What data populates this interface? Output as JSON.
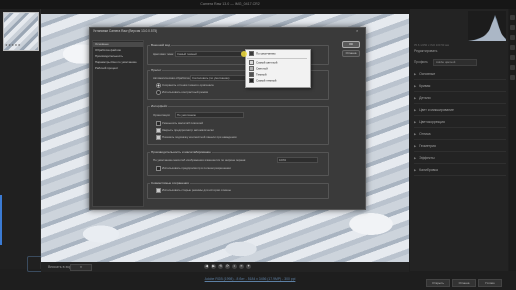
{
  "app": {
    "title": "Camera Raw 13.0  —  IMG_0417.CR2",
    "colors": {
      "accent": "#3b7bd4",
      "dialog_bg": "#3a3a3a",
      "panel_bg": "#232323"
    }
  },
  "filmstrip": {
    "thumb_rating": "★★★★★"
  },
  "dialog": {
    "title": "Установки Camera Raw  (Версия 13.0.0.575)",
    "close_icon": "×",
    "nav": [
      {
        "label": "Основные",
        "selected": true
      },
      {
        "label": "Обработка файлов",
        "selected": false
      },
      {
        "label": "Производительность",
        "selected": false
      },
      {
        "label": "Параметры Кэш по умолчанию",
        "selected": false
      },
      {
        "label": "Рабочий процесс",
        "selected": false
      }
    ],
    "ok_label": "ОК",
    "cancel_label": "Отмена",
    "appearance": {
      "title": "Внешний вид",
      "theme_label": "Цветовая тема:",
      "theme_value": "Самый темный"
    },
    "presets": {
      "title": "Пресет",
      "apply_label": "Автоматическая обработка",
      "apply_value": "Согласовать (по умолчанию)",
      "radio1": "Сохранять оттенки темного оригинала",
      "radio2": "Использовать контрастный режим"
    },
    "interface": {
      "title": "Интерфейс",
      "orient_label": "Ориентация:",
      "orient_value": "По умолчанию",
      "opt1": "Уменьшить масштаб пикселей",
      "opt2": "Закрыть предпросмотр автоматически",
      "opt3": "Показать подсказку контекстной панели при наведении"
    },
    "processing": {
      "title": "Производительность и масштабирование",
      "line": "По умолчанию масштаб изображения изменяется по ширине экрана:",
      "value": "100%",
      "check": "Использовать предпросмотр в полном разрешении"
    },
    "compat": {
      "title": "Совместимые сохранения",
      "check": "Использовать старые режимы для истории отмены"
    },
    "dropdown": {
      "items": [
        {
          "label": "По умолчанию",
          "swatch": "#3a3a3a"
        },
        {
          "label": "Самый светлый",
          "swatch": "#d9d9d9"
        },
        {
          "label": "Светлый",
          "swatch": "#b0b0b0"
        },
        {
          "label": "Темный",
          "swatch": "#535353"
        },
        {
          "label": "Самый темный",
          "swatch": "#262626"
        }
      ]
    }
  },
  "bottom": {
    "fit_label": "Вписать в экран (12.3%)",
    "zoom_value": "▾",
    "nav_icons": [
      "◀",
      "▶",
      "⟲",
      "⟳",
      "◐",
      "≡",
      "✦"
    ],
    "footer_link": "Adobe RGB (1998) - 8 бит - 5184 x 3456 (17.9MP) - 300 ppi",
    "open_label": "Открыть",
    "cancel_label": "Отмена",
    "done_label": "Готово"
  },
  "right": {
    "hist_values": "f/5.6   1/250 c   ISO 100   50 мм",
    "hist_info": "Редактировать",
    "profile_label": "Профиль",
    "profile_value": "Adobe цветной",
    "sections": [
      "Основные",
      "Кривая",
      "Детали",
      "Цвет и микширование",
      "Цветокоррекция",
      "Оптика",
      "Геометрия",
      "Эффекты",
      "Калибровка"
    ]
  }
}
